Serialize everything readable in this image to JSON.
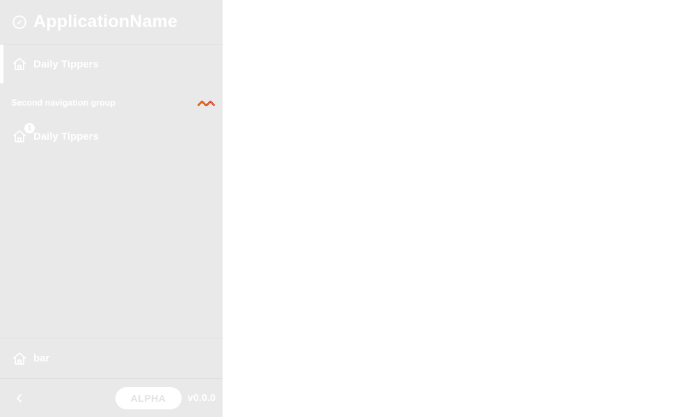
{
  "app": {
    "name": "ApplicationName",
    "logo_icon": "compass-icon"
  },
  "nav": {
    "primary": [
      {
        "label": "Daily Tippers",
        "icon": "home-icon",
        "active": true
      }
    ],
    "groups": [
      {
        "title": "Second navigation group",
        "collapse_icon": "chevron-up-icon",
        "items": [
          {
            "label": "Daily Tippers",
            "icon": "home-icon",
            "badge": "1"
          }
        ]
      }
    ],
    "bottom": [
      {
        "label": "bar",
        "icon": "home-icon"
      }
    ]
  },
  "footer": {
    "back_icon": "chevron-left-icon",
    "release_tag": "ALPHA",
    "version": "v0.0.0"
  },
  "colors": {
    "sidebar_bg": "#e9e9e9",
    "text": "#ffffff",
    "collapse_icon_stroke": "#d98e00",
    "collapse_icon_accent": "#c00000"
  }
}
